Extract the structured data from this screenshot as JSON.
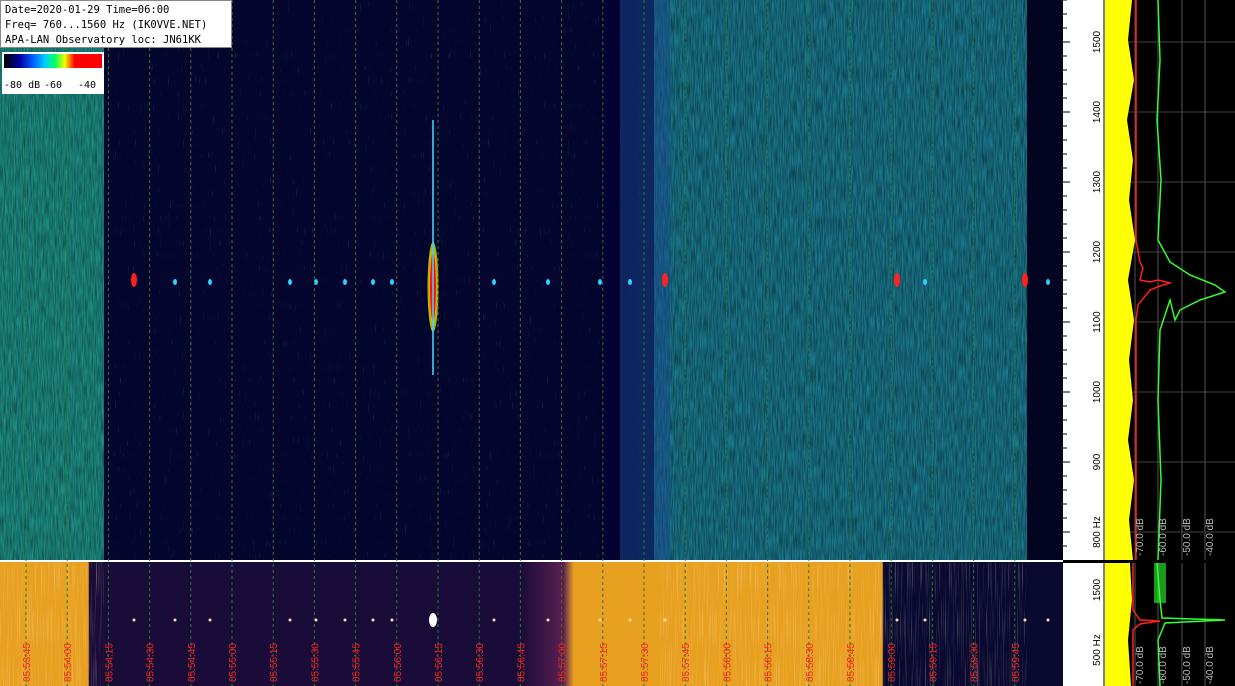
{
  "info": {
    "line1": "Date=2020-01-29 Time=06:00",
    "line2": "Freq= 760...1560 Hz (IK0VVE.NET)",
    "line3": "APA-LAN Observatory loc: JN61KK"
  },
  "colorbar": {
    "labels": [
      "-80 dB",
      "-60",
      "-40"
    ]
  },
  "main_freq_axis": {
    "ticks": [
      "1500",
      "1400",
      "1300",
      "1200",
      "1100",
      "1000",
      "900",
      "800 Hz"
    ],
    "range_hz": [
      760,
      1560
    ]
  },
  "bottom_freq_axis": {
    "ticks": [
      "1500",
      "500 Hz"
    ]
  },
  "time_labels": [
    "05:53:45",
    "05:54:00",
    "05:54:15",
    "05:54:30",
    "05:54:45",
    "05:55:00",
    "05:55:15",
    "05:55:30",
    "05:55:45",
    "05:56:00",
    "05:56:15",
    "05:56:30",
    "05:56:45",
    "05:57:00",
    "05:57:15",
    "05:57:30",
    "05:57:45",
    "05:58:00",
    "05:58:15",
    "05:58:30",
    "05:58:45",
    "05:59:00",
    "05:59:15",
    "05:59:30",
    "05:59:45"
  ],
  "spectrum_labels": {
    "main": [
      "-70.0 dB",
      "-60.0 dB",
      "-50.0 dB",
      "-40.0 dB"
    ],
    "bottom": [
      "-70.0 dB",
      "-60.0 dB",
      "-50.0 dB",
      "-40.0 dB"
    ]
  },
  "colors": {
    "grid": "#2a7a2a",
    "time_label": "#ff2020",
    "axis_text": "#000000",
    "spectrum_yellow": "#ffff00",
    "spectrum_green": "#30ff30",
    "spectrum_red": "#ff2020"
  }
}
